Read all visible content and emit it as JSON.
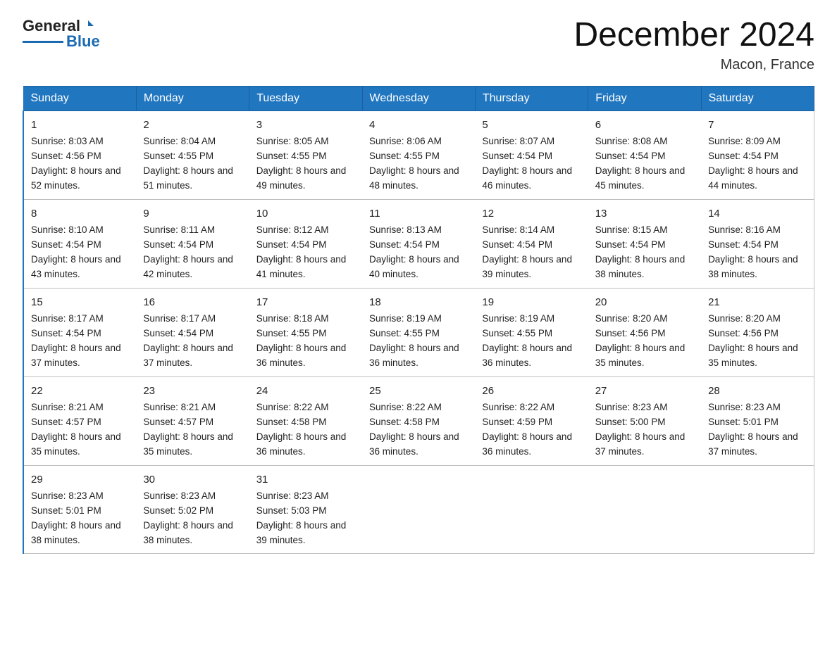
{
  "logo": {
    "general": "General",
    "blue": "Blue"
  },
  "header": {
    "month_title": "December 2024",
    "location": "Macon, France"
  },
  "days_of_week": [
    "Sunday",
    "Monday",
    "Tuesday",
    "Wednesday",
    "Thursday",
    "Friday",
    "Saturday"
  ],
  "weeks": [
    [
      {
        "day": "1",
        "sunrise": "8:03 AM",
        "sunset": "4:56 PM",
        "daylight": "8 hours and 52 minutes."
      },
      {
        "day": "2",
        "sunrise": "8:04 AM",
        "sunset": "4:55 PM",
        "daylight": "8 hours and 51 minutes."
      },
      {
        "day": "3",
        "sunrise": "8:05 AM",
        "sunset": "4:55 PM",
        "daylight": "8 hours and 49 minutes."
      },
      {
        "day": "4",
        "sunrise": "8:06 AM",
        "sunset": "4:55 PM",
        "daylight": "8 hours and 48 minutes."
      },
      {
        "day": "5",
        "sunrise": "8:07 AM",
        "sunset": "4:54 PM",
        "daylight": "8 hours and 46 minutes."
      },
      {
        "day": "6",
        "sunrise": "8:08 AM",
        "sunset": "4:54 PM",
        "daylight": "8 hours and 45 minutes."
      },
      {
        "day": "7",
        "sunrise": "8:09 AM",
        "sunset": "4:54 PM",
        "daylight": "8 hours and 44 minutes."
      }
    ],
    [
      {
        "day": "8",
        "sunrise": "8:10 AM",
        "sunset": "4:54 PM",
        "daylight": "8 hours and 43 minutes."
      },
      {
        "day": "9",
        "sunrise": "8:11 AM",
        "sunset": "4:54 PM",
        "daylight": "8 hours and 42 minutes."
      },
      {
        "day": "10",
        "sunrise": "8:12 AM",
        "sunset": "4:54 PM",
        "daylight": "8 hours and 41 minutes."
      },
      {
        "day": "11",
        "sunrise": "8:13 AM",
        "sunset": "4:54 PM",
        "daylight": "8 hours and 40 minutes."
      },
      {
        "day": "12",
        "sunrise": "8:14 AM",
        "sunset": "4:54 PM",
        "daylight": "8 hours and 39 minutes."
      },
      {
        "day": "13",
        "sunrise": "8:15 AM",
        "sunset": "4:54 PM",
        "daylight": "8 hours and 38 minutes."
      },
      {
        "day": "14",
        "sunrise": "8:16 AM",
        "sunset": "4:54 PM",
        "daylight": "8 hours and 38 minutes."
      }
    ],
    [
      {
        "day": "15",
        "sunrise": "8:17 AM",
        "sunset": "4:54 PM",
        "daylight": "8 hours and 37 minutes."
      },
      {
        "day": "16",
        "sunrise": "8:17 AM",
        "sunset": "4:54 PM",
        "daylight": "8 hours and 37 minutes."
      },
      {
        "day": "17",
        "sunrise": "8:18 AM",
        "sunset": "4:55 PM",
        "daylight": "8 hours and 36 minutes."
      },
      {
        "day": "18",
        "sunrise": "8:19 AM",
        "sunset": "4:55 PM",
        "daylight": "8 hours and 36 minutes."
      },
      {
        "day": "19",
        "sunrise": "8:19 AM",
        "sunset": "4:55 PM",
        "daylight": "8 hours and 36 minutes."
      },
      {
        "day": "20",
        "sunrise": "8:20 AM",
        "sunset": "4:56 PM",
        "daylight": "8 hours and 35 minutes."
      },
      {
        "day": "21",
        "sunrise": "8:20 AM",
        "sunset": "4:56 PM",
        "daylight": "8 hours and 35 minutes."
      }
    ],
    [
      {
        "day": "22",
        "sunrise": "8:21 AM",
        "sunset": "4:57 PM",
        "daylight": "8 hours and 35 minutes."
      },
      {
        "day": "23",
        "sunrise": "8:21 AM",
        "sunset": "4:57 PM",
        "daylight": "8 hours and 35 minutes."
      },
      {
        "day": "24",
        "sunrise": "8:22 AM",
        "sunset": "4:58 PM",
        "daylight": "8 hours and 36 minutes."
      },
      {
        "day": "25",
        "sunrise": "8:22 AM",
        "sunset": "4:58 PM",
        "daylight": "8 hours and 36 minutes."
      },
      {
        "day": "26",
        "sunrise": "8:22 AM",
        "sunset": "4:59 PM",
        "daylight": "8 hours and 36 minutes."
      },
      {
        "day": "27",
        "sunrise": "8:23 AM",
        "sunset": "5:00 PM",
        "daylight": "8 hours and 37 minutes."
      },
      {
        "day": "28",
        "sunrise": "8:23 AM",
        "sunset": "5:01 PM",
        "daylight": "8 hours and 37 minutes."
      }
    ],
    [
      {
        "day": "29",
        "sunrise": "8:23 AM",
        "sunset": "5:01 PM",
        "daylight": "8 hours and 38 minutes."
      },
      {
        "day": "30",
        "sunrise": "8:23 AM",
        "sunset": "5:02 PM",
        "daylight": "8 hours and 38 minutes."
      },
      {
        "day": "31",
        "sunrise": "8:23 AM",
        "sunset": "5:03 PM",
        "daylight": "8 hours and 39 minutes."
      },
      {
        "day": "",
        "sunrise": "",
        "sunset": "",
        "daylight": ""
      },
      {
        "day": "",
        "sunrise": "",
        "sunset": "",
        "daylight": ""
      },
      {
        "day": "",
        "sunrise": "",
        "sunset": "",
        "daylight": ""
      },
      {
        "day": "",
        "sunrise": "",
        "sunset": "",
        "daylight": ""
      }
    ]
  ]
}
